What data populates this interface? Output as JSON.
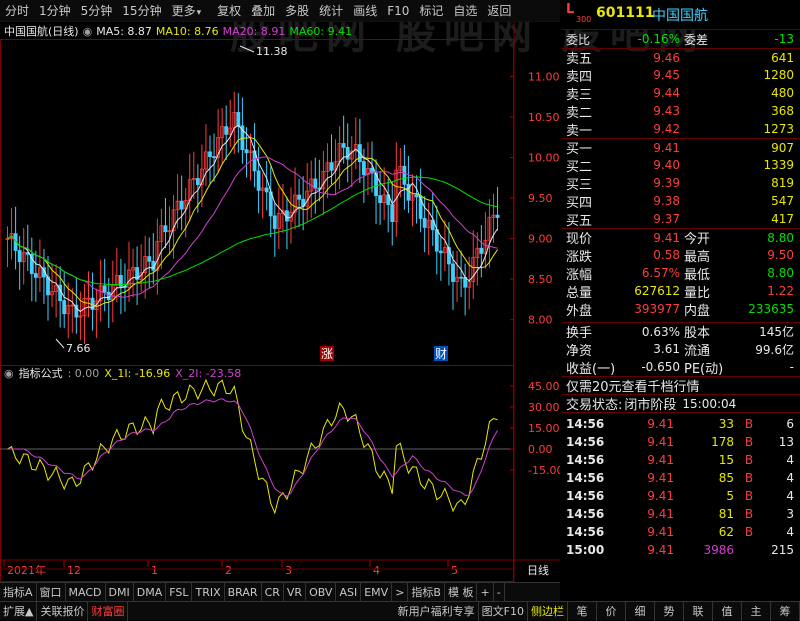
{
  "toolbar": {
    "items": [
      "分时",
      "1分钟",
      "5分钟",
      "15分钟",
      "更多",
      "复权",
      "叠加",
      "多股",
      "统计",
      "画线",
      "F10",
      "标记",
      "自选",
      "返回"
    ],
    "dropdown_index": 4
  },
  "watermark": "股吧网 股吧网 股吧网",
  "header": {
    "mark": "L",
    "mark_sub": "300",
    "code": "601111",
    "name": "中国国航"
  },
  "chart": {
    "title": "中国国航(日线)",
    "ma": [
      {
        "label": "MA5: 8.87",
        "color": "#e8e8e8"
      },
      {
        "label": "MA10: 8.76",
        "color": "#e8e800"
      },
      {
        "label": "MA20: 8.91",
        "color": "#d040d0"
      },
      {
        "label": "MA60: 9.41",
        "color": "#00e000"
      }
    ],
    "high_label": "11.38",
    "low_label": "7.66",
    "price_ticks": [
      "11.00",
      "10.50",
      "10.00",
      "9.50",
      "9.00",
      "8.50",
      "8.00"
    ],
    "markers": [
      {
        "text": "涨",
        "color": "#ff3c3c"
      },
      {
        "text": "财",
        "color": "#40a0ff"
      }
    ]
  },
  "indicator": {
    "name": "指标公式",
    "values": [
      {
        "label": ": 0.00",
        "color": "#a0a0a0"
      },
      {
        "label": "X_1I: -16.96",
        "color": "#e8e800"
      },
      {
        "label": "X_2I: -23.58",
        "color": "#d040d0"
      }
    ],
    "ticks": [
      "45.00",
      "30.00",
      "15.00",
      "0.00",
      "-15.00"
    ]
  },
  "x_axis": {
    "labels": [
      "2021年",
      "12",
      "1",
      "2",
      "3",
      "4",
      "5"
    ],
    "right_label": "日线"
  },
  "quote": {
    "wb": {
      "label": "委比",
      "value": "-0.16%",
      "label2": "委差",
      "value2": "-13"
    },
    "asks": [
      {
        "label": "卖五",
        "price": "9.46",
        "vol": "641"
      },
      {
        "label": "卖四",
        "price": "9.45",
        "vol": "1280"
      },
      {
        "label": "卖三",
        "price": "9.44",
        "vol": "480"
      },
      {
        "label": "卖二",
        "price": "9.43",
        "vol": "368"
      },
      {
        "label": "卖一",
        "price": "9.42",
        "vol": "1273"
      }
    ],
    "bids": [
      {
        "label": "买一",
        "price": "9.41",
        "vol": "907"
      },
      {
        "label": "买二",
        "price": "9.40",
        "vol": "1339"
      },
      {
        "label": "买三",
        "price": "9.39",
        "vol": "819"
      },
      {
        "label": "买四",
        "price": "9.38",
        "vol": "547"
      },
      {
        "label": "买五",
        "price": "9.37",
        "vol": "417"
      }
    ],
    "stats": [
      {
        "l1": "现价",
        "v1": "9.41",
        "c1": "#ff3c3c",
        "l2": "今开",
        "v2": "8.80",
        "c2": "#00e000"
      },
      {
        "l1": "涨跌",
        "v1": "0.58",
        "c1": "#ff3c3c",
        "l2": "最高",
        "v2": "9.50",
        "c2": "#ff3c3c"
      },
      {
        "l1": "涨幅",
        "v1": "6.57%",
        "c1": "#ff3c3c",
        "l2": "最低",
        "v2": "8.80",
        "c2": "#00e000"
      },
      {
        "l1": "总量",
        "v1": "627612",
        "c1": "#e8e800",
        "l2": "量比",
        "v2": "1.22",
        "c2": "#ff3c3c"
      },
      {
        "l1": "外盘",
        "v1": "393977",
        "c1": "#ff3c3c",
        "l2": "内盘",
        "v2": "233635",
        "c2": "#00e000"
      }
    ],
    "stats2": [
      {
        "l1": "换手",
        "v1": "0.63%",
        "c1": "#e8e8e8",
        "l2": "股本",
        "v2": "145亿",
        "c2": "#e8e8e8"
      },
      {
        "l1": "净资",
        "v1": "3.61",
        "c1": "#e8e8e8",
        "l2": "流通",
        "v2": "99.6亿",
        "c2": "#e8e8e8"
      },
      {
        "l1": "收益(一)",
        "v1": "-0.650",
        "c1": "#e8e8e8",
        "l2": "PE(动)",
        "v2": "-",
        "c2": "#e8e8e8"
      }
    ],
    "promo": "仅需20元查看千档行情",
    "status_label": "交易状态:",
    "status_value": "闭市阶段",
    "status_time": "15:00:04",
    "ticks": [
      {
        "t": "14:56",
        "p": "9.41",
        "v": "33",
        "d": "B",
        "n": "6"
      },
      {
        "t": "14:56",
        "p": "9.41",
        "v": "178",
        "d": "B",
        "n": "13"
      },
      {
        "t": "14:56",
        "p": "9.41",
        "v": "15",
        "d": "B",
        "n": "4"
      },
      {
        "t": "14:56",
        "p": "9.41",
        "v": "85",
        "d": "B",
        "n": "4"
      },
      {
        "t": "14:56",
        "p": "9.41",
        "v": "5",
        "d": "B",
        "n": "4"
      },
      {
        "t": "14:56",
        "p": "9.41",
        "v": "81",
        "d": "B",
        "n": "3"
      },
      {
        "t": "14:56",
        "p": "9.41",
        "v": "62",
        "d": "B",
        "n": "4"
      },
      {
        "t": "15:00",
        "p": "9.41",
        "v": "3986",
        "d": "",
        "n": "215"
      }
    ]
  },
  "bottom_tabs": [
    "指标A",
    "窗口",
    "MACD",
    "DMI",
    "DMA",
    "FSL",
    "TRIX",
    "BRAR",
    "CR",
    "VR",
    "OBV",
    "ASI",
    "EMV",
    ">",
    "指标B",
    "模 板",
    "+",
    "-"
  ],
  "status_bar": {
    "left": [
      "扩展▲",
      "关联报价",
      "财富圈"
    ],
    "mid": [
      "新用户福利专享",
      "图文F10",
      "侧边栏"
    ],
    "right": [
      "笔",
      "价",
      "细",
      "势",
      "联",
      "值",
      "主",
      "筹"
    ]
  }
}
